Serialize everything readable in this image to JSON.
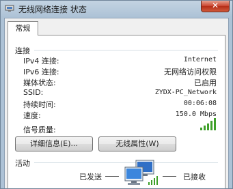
{
  "window": {
    "title": "无线网络连接 状态",
    "close_glyph": "✕"
  },
  "tabs": [
    {
      "label": "常规"
    }
  ],
  "connection": {
    "group_label": "连接",
    "rows": [
      {
        "label": "IPv4 连接:",
        "value": "Internet"
      },
      {
        "label": "IPv6 连接:",
        "value": "无网络访问权限"
      },
      {
        "label": "媒体状态:",
        "value": "已启用"
      },
      {
        "label": "SSID:",
        "value": "ZYDX-PC_Network"
      },
      {
        "label": "持续时间:",
        "value": "00:06:08"
      },
      {
        "label": "速度:",
        "value": "150.0 Mbps"
      }
    ],
    "signal_label": "信号质量:",
    "signal_bars": 5,
    "signal_color": "#3fa02a"
  },
  "buttons": {
    "details": "详细信息(E)...",
    "wireless_properties": "无线属性(W)"
  },
  "activity": {
    "group_label": "活动",
    "sent_label": "已发送",
    "received_label": "已接收"
  },
  "icons": {
    "app": "network-adapter-icon",
    "signal": "signal-strength-icon",
    "activity": "network-computers-icon"
  }
}
